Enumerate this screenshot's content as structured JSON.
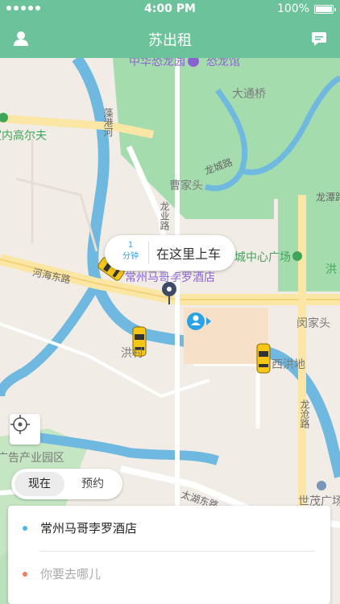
{
  "status_bar": {
    "time": "4:00 PM",
    "battery": "100%"
  },
  "nav": {
    "title": "苏出租",
    "left_icon": "user-icon",
    "right_icon": "message-icon"
  },
  "map": {
    "labels": {
      "dinosaur_park": "中华恐龙园",
      "dinosaur_hall": "恐龙馆",
      "datongqiao": "大通桥",
      "golf": "室内高尔夫",
      "zaogang_river": "藻港河",
      "longcheng_rd": "龙城路",
      "caojiatou": "曹家头",
      "longye_rd": "龙业路",
      "longtan_rd": "龙潭路",
      "hehai_east_rd": "河海东路",
      "city_plaza": "城中心广场",
      "hong": "洪",
      "marco_polo": "常州马哥孛罗酒店",
      "minjiatou": "闵家头",
      "hongcun": "洪村",
      "xihongdi": "西洪地",
      "longcang_rd": "龙沧路",
      "ad_park": "广告产业园区",
      "taihu_east_rd": "太湖东路",
      "shimao": "世茂广场"
    },
    "pickup_bubble": {
      "eta_value": "1",
      "eta_unit": "分钟",
      "text": "在这里上车"
    }
  },
  "time_toggle": {
    "now": "现在",
    "reserve": "预约",
    "selected": "now"
  },
  "trip_card": {
    "origin": "常州马哥孛罗酒店",
    "destination_placeholder": "你要去哪儿",
    "origin_dot_color": "#4ab6e8",
    "destination_dot_color": "#f27b5b"
  },
  "colors": {
    "brand": "#6cc39b",
    "water": "#6fb8e0",
    "park": "#9fd8a8"
  }
}
